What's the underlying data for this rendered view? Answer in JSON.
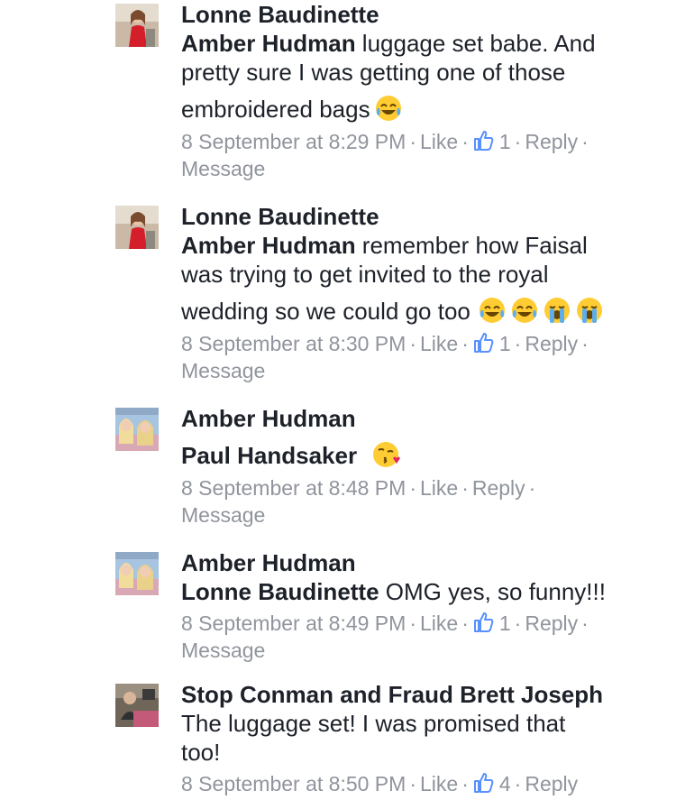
{
  "comments": [
    {
      "author": "Lonne Baudinette",
      "line1_mention": "Amber Hudman",
      "line1_rest": " luggage set babe. And",
      "line2": "pretty sure I was getting one of those",
      "line3": "embroidered bags",
      "emojis": [
        "face-with-tears-of-joy"
      ],
      "time": "8 September at 8:29 PM",
      "like": "Like",
      "reaction_count": "1",
      "reply": "Reply",
      "message": "Message",
      "avatar": "woman-in-red-dress"
    },
    {
      "author": "Lonne Baudinette",
      "line1_mention": "Amber Hudman",
      "line1_rest": " remember how Faisal",
      "line2": "was trying to get invited to the royal",
      "line3": "wedding so we could go too",
      "emojis": [
        "face-with-tears-of-joy",
        "face-with-tears-of-joy",
        "loudly-crying-face",
        "loudly-crying-face"
      ],
      "time": "8 September at 8:30 PM",
      "like": "Like",
      "reaction_count": "1",
      "reply": "Reply",
      "message": "Message",
      "avatar": "woman-in-red-dress"
    },
    {
      "author": "Amber Hudman",
      "line1_mention": "Paul Handsaker",
      "emojis": [
        "face-blowing-a-kiss"
      ],
      "time": "8 September at 8:48 PM",
      "like": "Like",
      "reply": "Reply",
      "message": "Message",
      "avatar": "two-blonde-women"
    },
    {
      "author": "Amber Hudman",
      "line1_mention": "Lonne Baudinette",
      "line1_rest": "  OMG yes, so funny!!!",
      "time": "8 September at 8:49 PM",
      "like": "Like",
      "reaction_count": "1",
      "reply": "Reply",
      "message": "Message",
      "avatar": "two-blonde-women"
    },
    {
      "author": "Stop Conman and Fraud Brett Joseph",
      "line1_rest": "The luggage set! I was promised that",
      "line2": "too!",
      "time": "8 September at 8:50 PM",
      "like": "Like",
      "reaction_count": "4",
      "reply": "Reply",
      "avatar": "man-at-desk"
    }
  ],
  "colors": {
    "text": "#1d2129",
    "meta": "#90949c",
    "like_icon": "#5890ff"
  }
}
